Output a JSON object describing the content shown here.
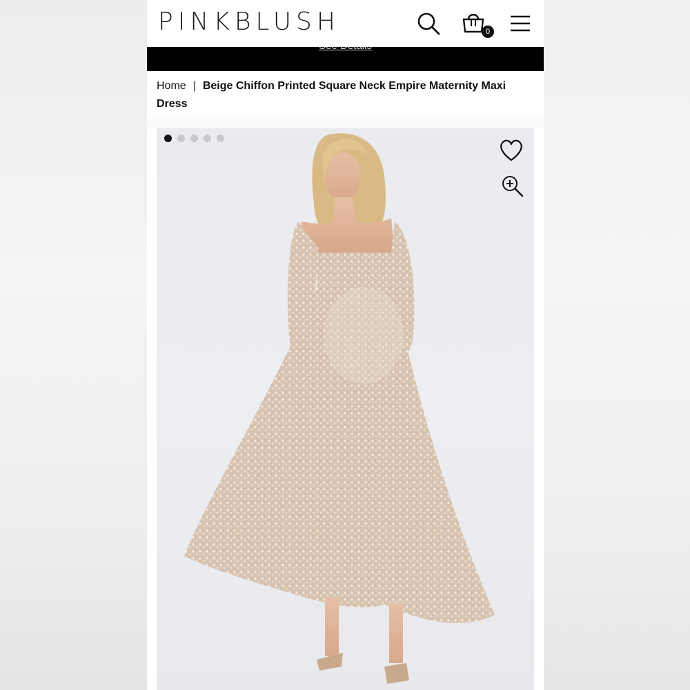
{
  "header": {
    "logo": "PINKBLUSH",
    "search_icon": "search-icon",
    "bag_icon": "shopping-bag-icon",
    "bag_count": "0",
    "menu_icon": "hamburger-menu-icon"
  },
  "promo": {
    "link_label": "See Details"
  },
  "breadcrumb": {
    "home": "Home",
    "separator": "|",
    "current": "Beige Chiffon Printed Square Neck Empire Maternity Maxi Dress"
  },
  "gallery": {
    "image_count": 5,
    "active_index": 1,
    "wishlist_icon": "heart-icon",
    "zoom_icon": "zoom-in-icon"
  },
  "colors": {
    "brand_black": "#111111",
    "dress_beige": "#d9c6b3",
    "image_background": "#e9ebef"
  }
}
